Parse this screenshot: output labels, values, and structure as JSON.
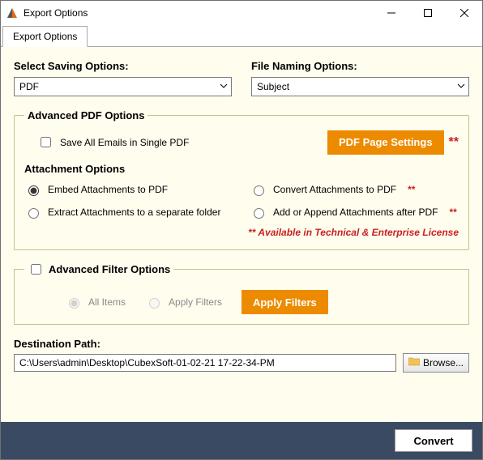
{
  "titlebar": {
    "title": "Export Options"
  },
  "tab": {
    "label": "Export Options"
  },
  "saving": {
    "label": "Select Saving Options:",
    "value": "PDF"
  },
  "naming": {
    "label": "File Naming Options:",
    "value": "Subject"
  },
  "advanced_pdf": {
    "legend": "Advanced PDF Options",
    "save_single": "Save All Emails in Single PDF",
    "page_settings_btn": "PDF Page Settings",
    "stars": "**"
  },
  "attachments": {
    "legend": "Attachment Options",
    "embed": "Embed Attachments to PDF",
    "extract": "Extract Attachments to a separate folder",
    "convert": "Convert Attachments to PDF",
    "append": "Add or Append Attachments after PDF",
    "stars": "**",
    "note": "**  Available in Technical & Enterprise License"
  },
  "filters": {
    "legend": "Advanced Filter Options",
    "all_items": "All Items",
    "apply_filters_radio": "Apply Filters",
    "apply_filters_btn": "Apply Filters"
  },
  "destination": {
    "label": "Destination Path:",
    "value": "C:\\Users\\admin\\Desktop\\CubexSoft-01-02-21 17-22-34-PM",
    "browse": "Browse..."
  },
  "bottom": {
    "convert": "Convert"
  }
}
